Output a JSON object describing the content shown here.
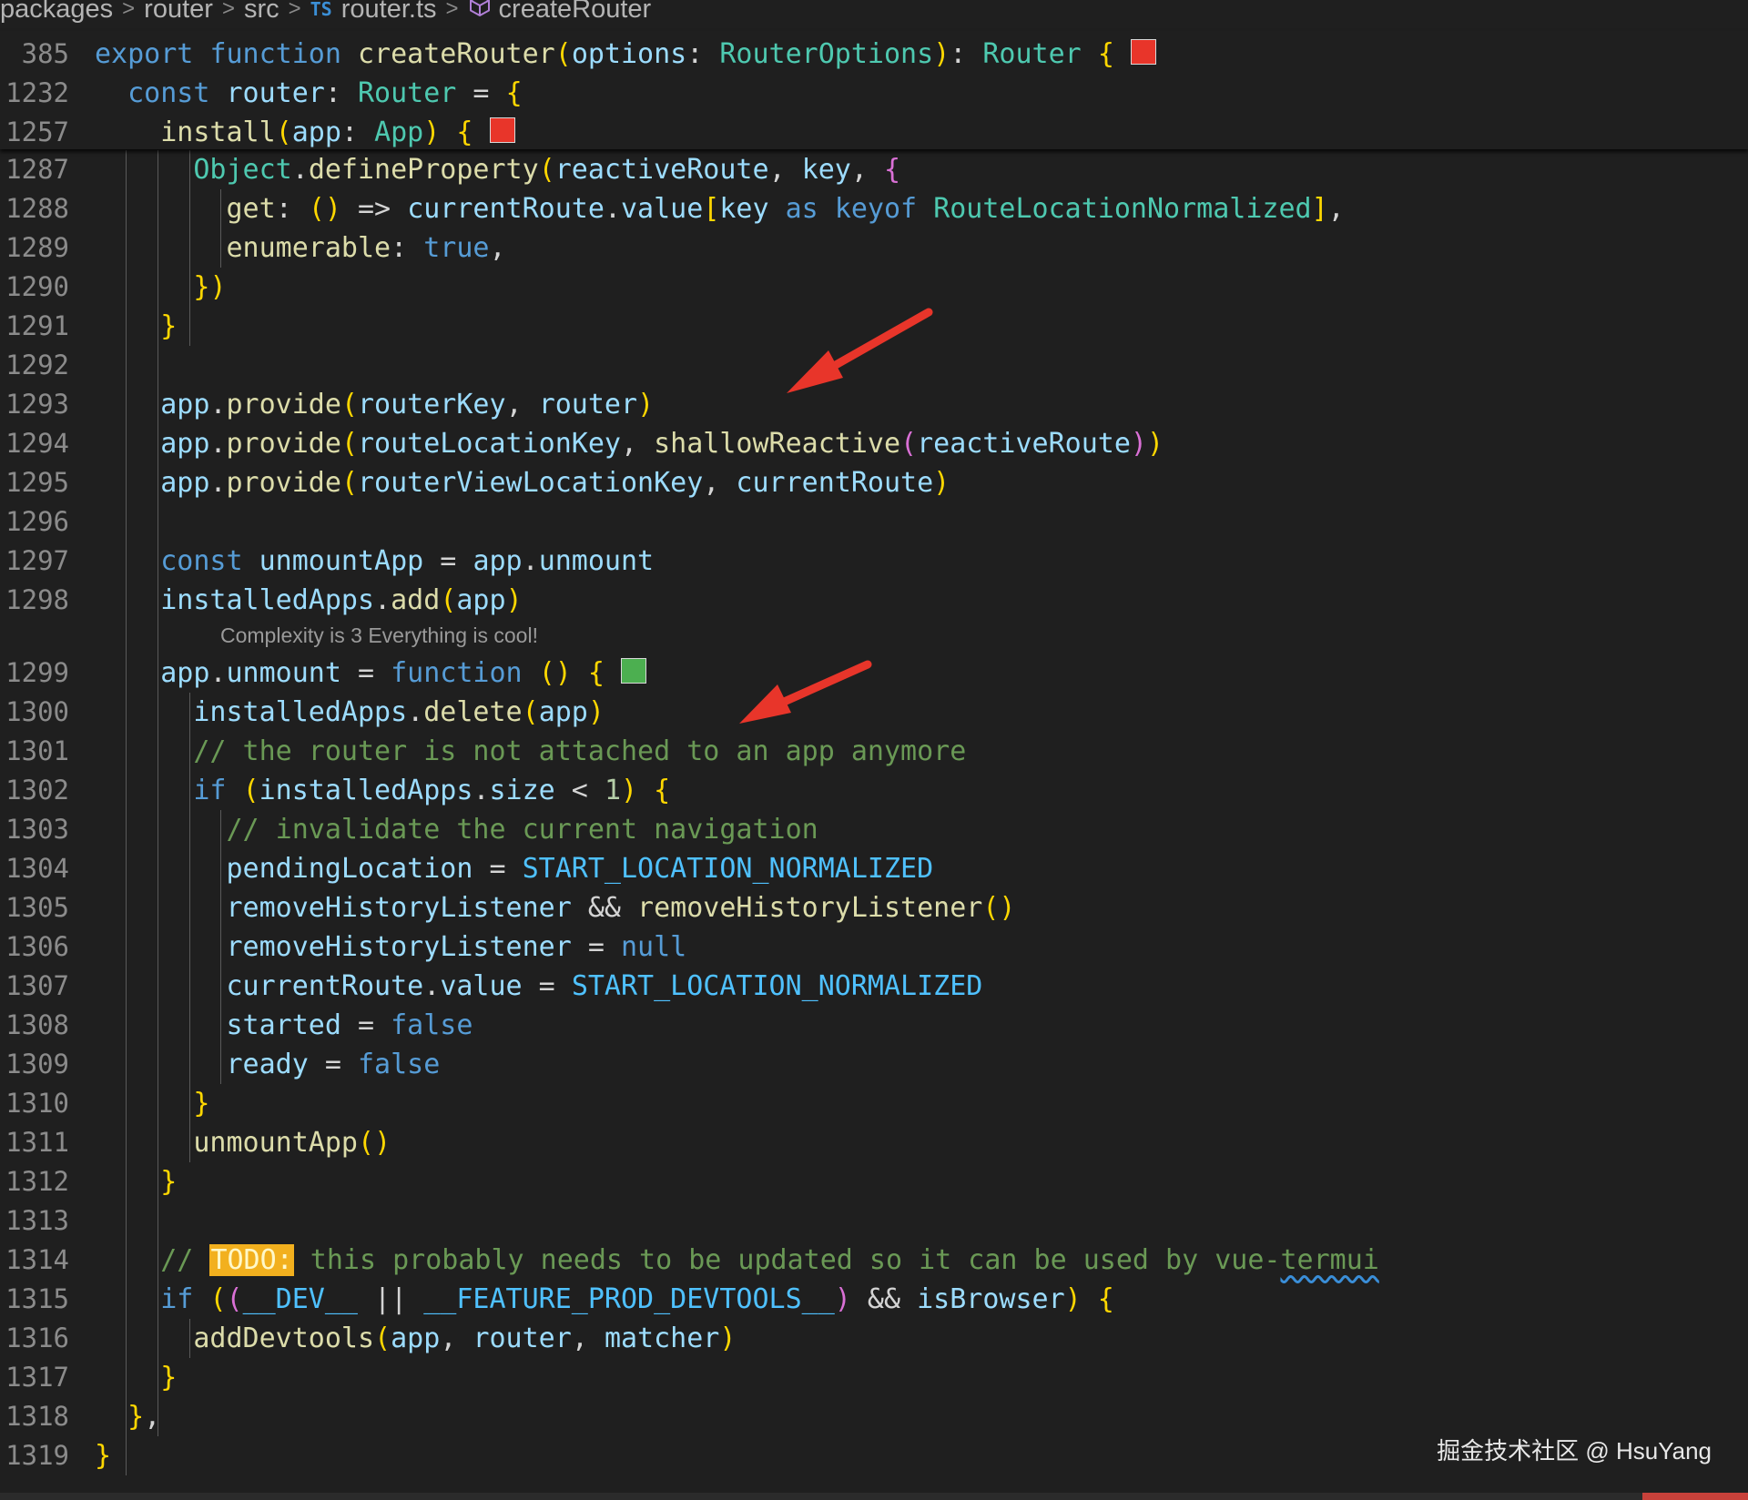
{
  "breadcrumb": {
    "items": [
      "packages",
      "router",
      "src",
      "router.ts",
      "createRouter"
    ],
    "file_badge": "TS"
  },
  "sticky_lines": [
    {
      "n": "385",
      "text": "export function createRouter(options: RouterOptions): Router {",
      "square": "red"
    },
    {
      "n": "1232",
      "text": "  const router: Router = {"
    },
    {
      "n": "1257",
      "text": "    install(app: App) {",
      "square": "red"
    }
  ],
  "lines": [
    {
      "n": "1287",
      "text": "      Object.defineProperty(reactiveRoute, key, {"
    },
    {
      "n": "1288",
      "text": "        get: () => currentRoute.value[key as keyof RouteLocationNormalized],"
    },
    {
      "n": "1289",
      "text": "        enumerable: true,"
    },
    {
      "n": "1290",
      "text": "      })"
    },
    {
      "n": "1291",
      "text": "    }"
    },
    {
      "n": "1292",
      "text": ""
    },
    {
      "n": "1293",
      "text": "    app.provide(routerKey, router)"
    },
    {
      "n": "1294",
      "text": "    app.provide(routeLocationKey, shallowReactive(reactiveRoute))"
    },
    {
      "n": "1295",
      "text": "    app.provide(routerViewLocationKey, currentRoute)"
    },
    {
      "n": "1296",
      "text": ""
    },
    {
      "n": "1297",
      "text": "    const unmountApp = app.unmount"
    },
    {
      "n": "1298",
      "text": "    installedApps.add(app)"
    },
    {
      "n": "1299",
      "text": "    app.unmount = function () {",
      "square": "green"
    },
    {
      "n": "1300",
      "text": "      installedApps.delete(app)"
    },
    {
      "n": "1301",
      "text": "      // the router is not attached to an app anymore"
    },
    {
      "n": "1302",
      "text": "      if (installedApps.size < 1) {"
    },
    {
      "n": "1303",
      "text": "        // invalidate the current navigation"
    },
    {
      "n": "1304",
      "text": "        pendingLocation = START_LOCATION_NORMALIZED"
    },
    {
      "n": "1305",
      "text": "        removeHistoryListener && removeHistoryListener()"
    },
    {
      "n": "1306",
      "text": "        removeHistoryListener = null"
    },
    {
      "n": "1307",
      "text": "        currentRoute.value = START_LOCATION_NORMALIZED"
    },
    {
      "n": "1308",
      "text": "        started = false"
    },
    {
      "n": "1309",
      "text": "        ready = false"
    },
    {
      "n": "1310",
      "text": "      }"
    },
    {
      "n": "1311",
      "text": "      unmountApp()"
    },
    {
      "n": "1312",
      "text": "    }"
    },
    {
      "n": "1313",
      "text": ""
    },
    {
      "n": "1314",
      "text": "    // TODO: this probably needs to be updated so it can be used by vue-termui"
    },
    {
      "n": "1315",
      "text": "    if ((__DEV__ || __FEATURE_PROD_DEVTOOLS__) && isBrowser) {"
    },
    {
      "n": "1316",
      "text": "      addDevtools(app, router, matcher)"
    },
    {
      "n": "1317",
      "text": "    }"
    },
    {
      "n": "1318",
      "text": "  },"
    },
    {
      "n": "1319",
      "text": "}"
    }
  ],
  "codelens": {
    "after_line": "1298",
    "text": "Complexity is 3 Everything is cool!"
  },
  "watermark": "掘金技术社区 @ HsuYang",
  "colors": {
    "background": "#1f1f1f",
    "keyword": "#569cd6",
    "function": "#dcdcaa",
    "variable": "#9cdcfe",
    "type": "#4ec9b0",
    "comment": "#6a9955",
    "todo_highlight": "#f2b01e",
    "complexity_bad": "#e8352a",
    "complexity_good": "#4caf50",
    "annotation_arrow": "#e8352a"
  }
}
